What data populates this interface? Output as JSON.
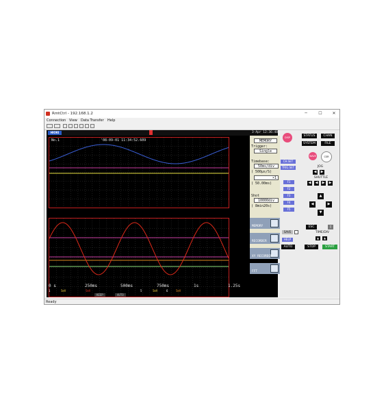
{
  "window": {
    "title": "RmtCtrl - 192.168.1.2",
    "controls": [
      "─",
      "☐",
      "✕"
    ]
  },
  "menu": [
    "Connection",
    "View",
    "Data Transfer",
    "Help"
  ],
  "statusbar": {
    "text": "Ready"
  },
  "scope": {
    "brand": "HIOKI",
    "datetime": "3-Apr 12:36:48",
    "screen_no": "No.1",
    "trigger_time": "'08-09-01 11:34:52.609",
    "x_ticks": [
      "0 s",
      "250ms",
      "500ms",
      "750ms",
      "1s",
      "1.25s"
    ],
    "channel_bar": [
      "1",
      "5mV",
      "5mV",
      "5",
      "5mV",
      "6",
      "5mV"
    ],
    "bottom_tags": [
      "KEEP",
      "AUTO"
    ],
    "side": {
      "function": "MEMORY",
      "trigger_label": "Trigger:",
      "trigger_value": "Single",
      "timebase_label": "Timebase:",
      "timebase_value": "50ms/div",
      "sample_value": "( 500µs/S)",
      "magnify": "×1",
      "range": "( 50.00ms)",
      "shot_label": "Shot",
      "shot_value": "10000div",
      "shot_time": "( 8min20s)"
    },
    "tabs": [
      "MEMORY",
      "RECORDER",
      "XY RECORDER",
      "FFT"
    ],
    "colors": {
      "blue": "#3a5fd8",
      "red": "#e02a1a",
      "yellow": "#e8e040",
      "green": "#8ce07a",
      "magenta": "#c83ca0",
      "orange": "#e08a20",
      "grid": "#3a3a3a",
      "border": "#c42020"
    }
  },
  "panel": {
    "disp": "DISP",
    "status": "STATUS",
    "chan": "CHAN",
    "system": "SYSTEM",
    "file": "FILE",
    "wave": "WAVE",
    "csr": "CSR",
    "chset": "CH.SET",
    "trigset": "TRIG.SET",
    "jog": "JOG",
    "shuttle": "SHUTTLE",
    "fkeys": [
      "F1",
      "F2",
      "F3",
      "F4",
      "F5"
    ],
    "esc": "ESC",
    "save": "SAVE",
    "help": "HELP",
    "time_div": "TIME/DIV",
    "auto": "AUTO",
    "stop": "STOP",
    "start": "START"
  }
}
